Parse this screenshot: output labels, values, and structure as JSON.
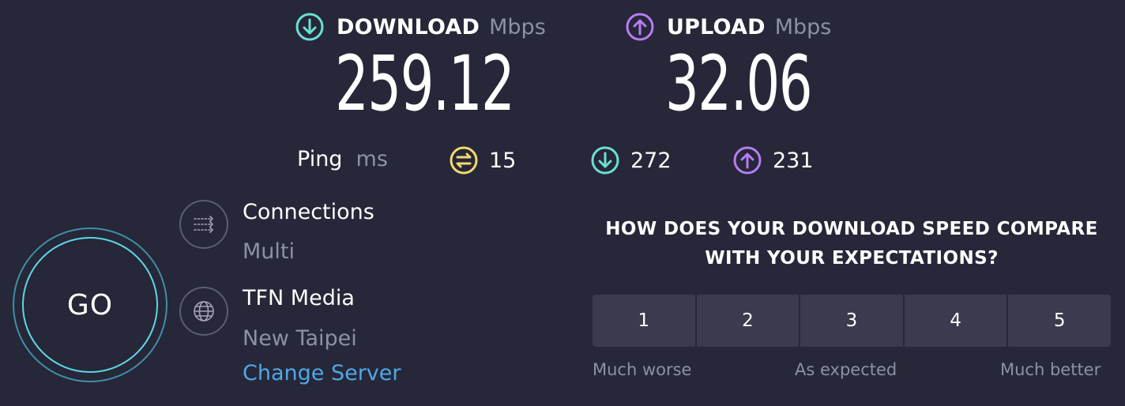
{
  "download": {
    "label": "DOWNLOAD",
    "unit": "Mbps",
    "value": "259.12",
    "icon": "download-arrow-icon",
    "color": "#6ae0d4"
  },
  "upload": {
    "label": "UPLOAD",
    "unit": "Mbps",
    "value": "32.06",
    "icon": "upload-arrow-icon",
    "color": "#b97cf5"
  },
  "ping": {
    "label": "Ping",
    "unit": "ms",
    "idle": "15",
    "download": "272",
    "upload": "231",
    "idle_color": "#f3da6e"
  },
  "go_button": {
    "label": "GO"
  },
  "connections": {
    "title": "Connections",
    "value": "Multi",
    "icon": "connections-icon"
  },
  "server": {
    "provider": "TFN Media",
    "location": "New Taipei",
    "change_label": "Change Server",
    "icon": "globe-icon"
  },
  "survey": {
    "question_line1": "HOW DOES YOUR DOWNLOAD SPEED COMPARE",
    "question_line2": "WITH YOUR EXPECTATIONS?",
    "options": [
      "1",
      "2",
      "3",
      "4",
      "5"
    ],
    "caption_left": "Much worse",
    "caption_middle": "As expected",
    "caption_right": "Much better"
  }
}
